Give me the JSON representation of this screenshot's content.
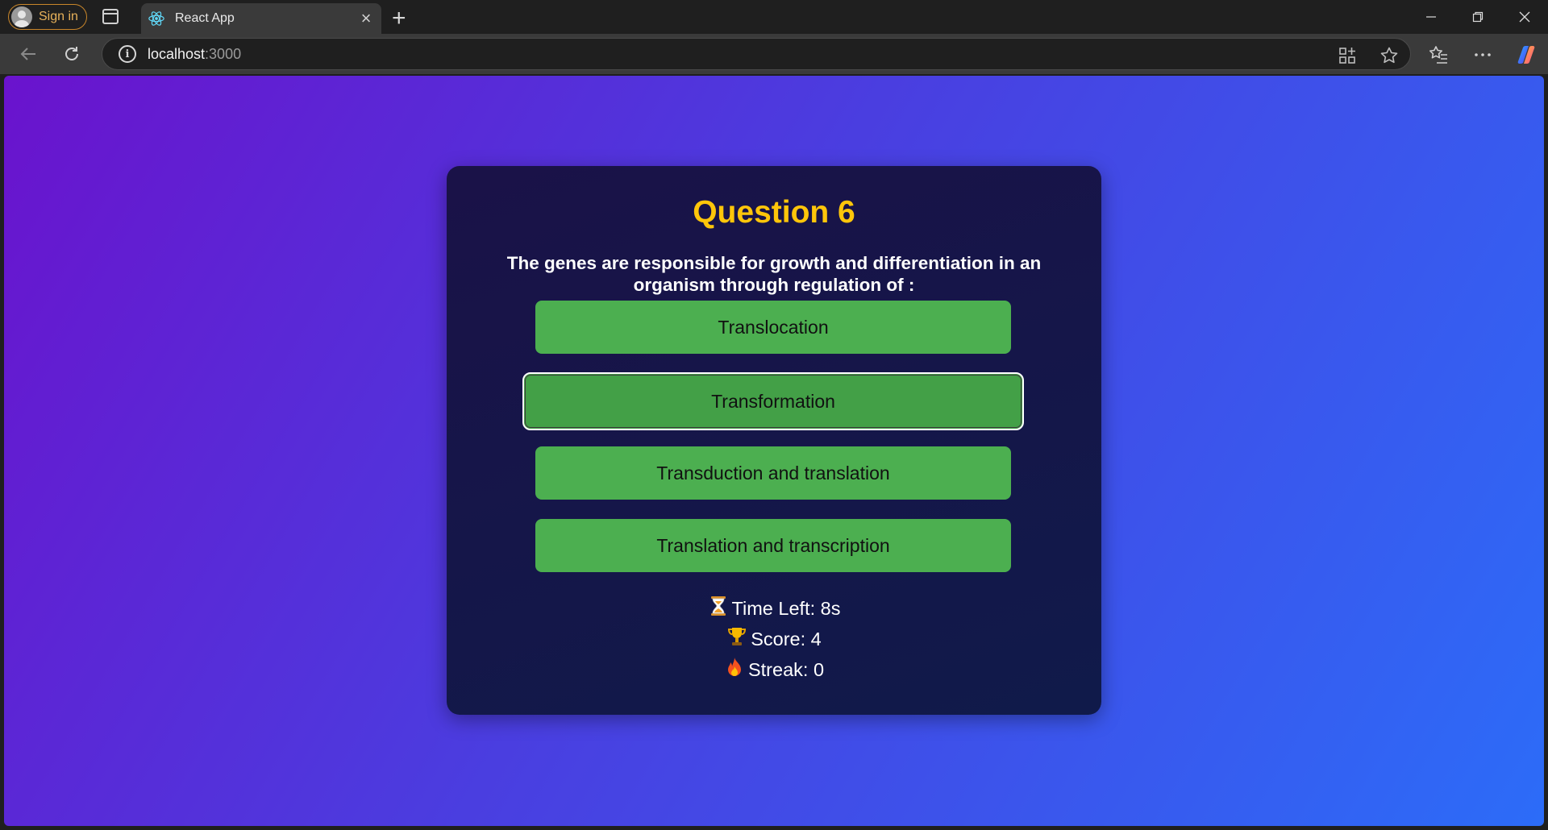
{
  "browser": {
    "signin_label": "Sign in",
    "tab_title": "React App",
    "url_host": "localhost",
    "url_port": ":3000"
  },
  "quiz": {
    "title": "Question 6",
    "question": "The genes are responsible for growth and differentiation in an organism through regulation of :",
    "options": [
      "Translocation",
      "Transformation",
      "Transduction and translation",
      "Translation and transcription"
    ],
    "hovered_option_index": 1,
    "stats": {
      "time_left": "Time Left: 8s",
      "score": "Score: 4",
      "streak": "Streak: 0"
    }
  },
  "colors": {
    "title": "#ffc60a",
    "option_bg": "#4caf50",
    "card_bg": "#131547",
    "bg_start": "#6a13cd",
    "bg_end": "#2c6cf8"
  }
}
